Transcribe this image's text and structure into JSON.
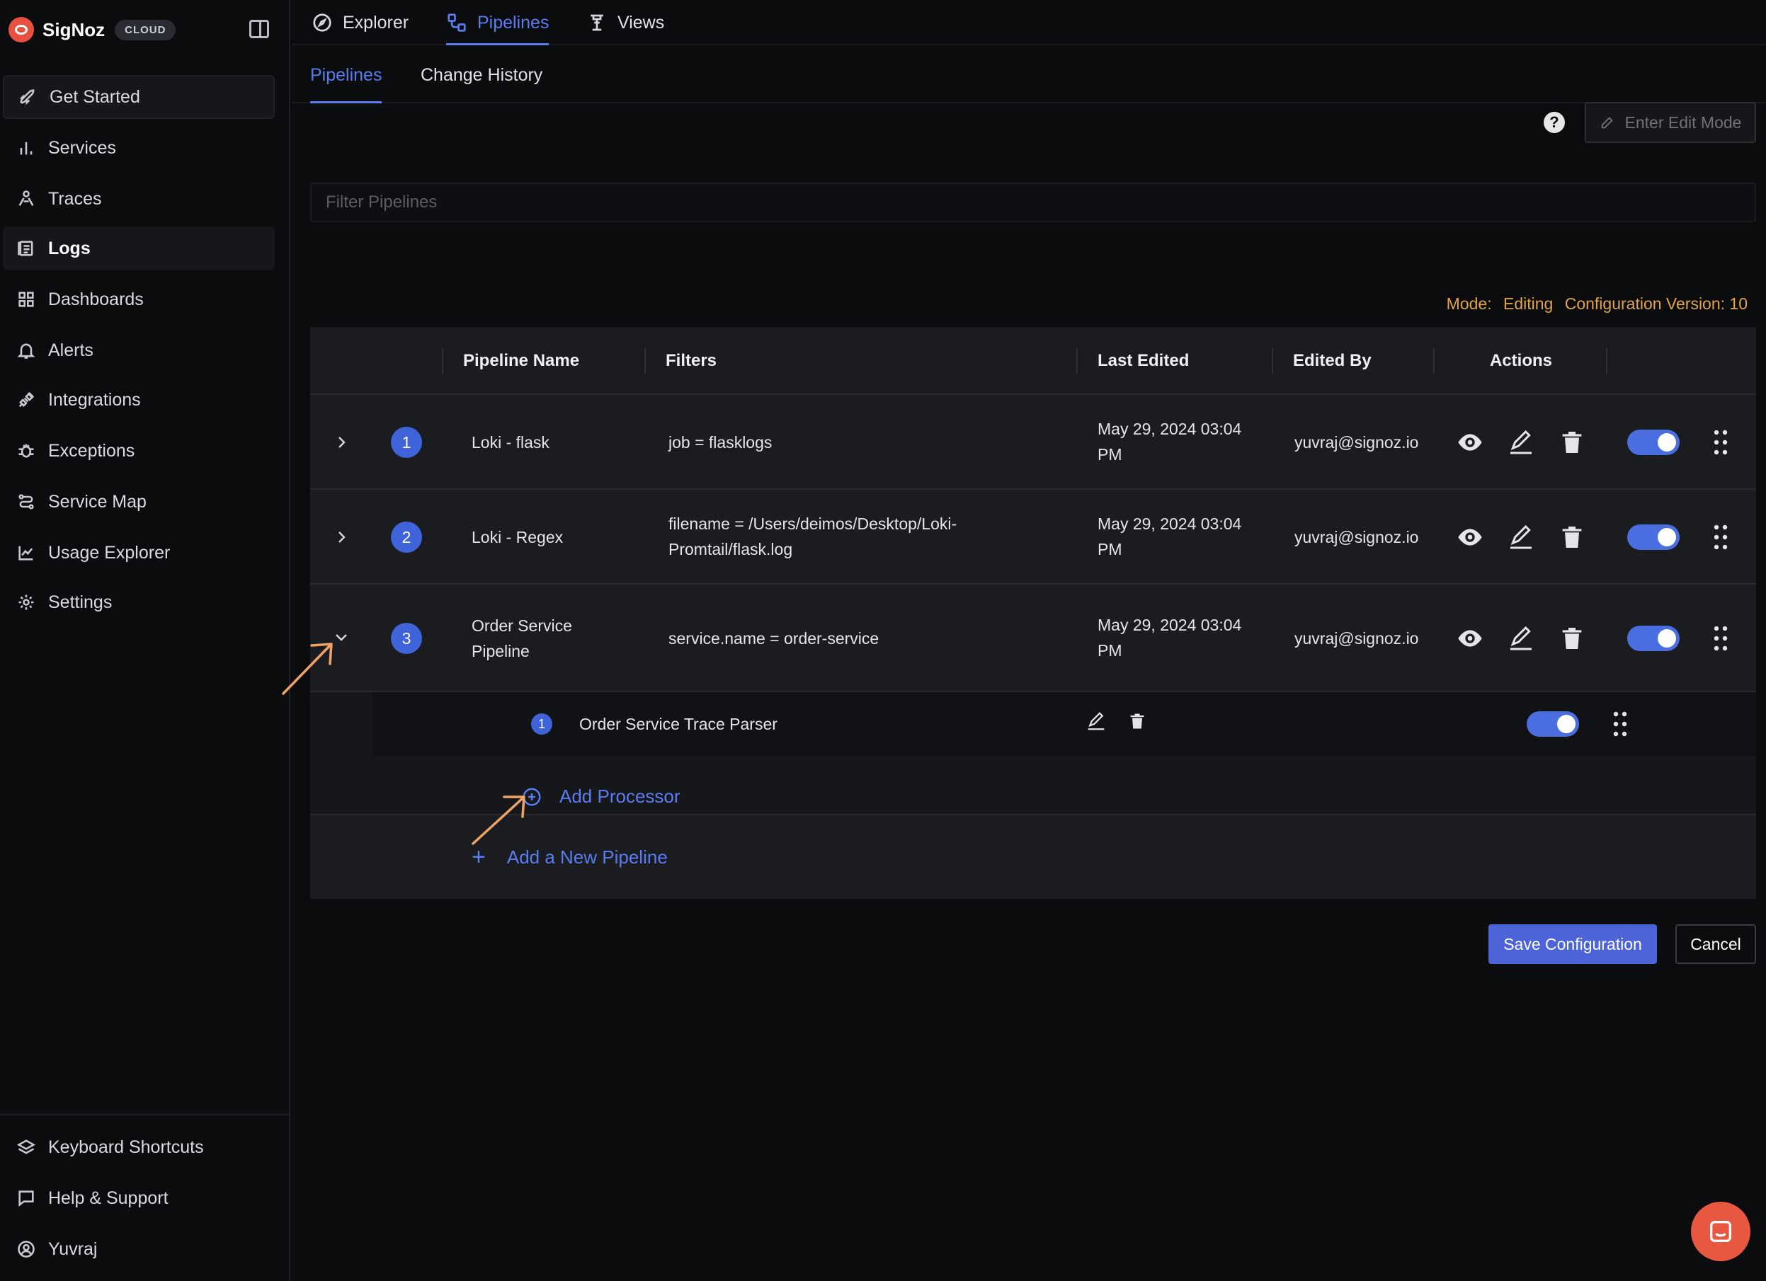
{
  "brand": {
    "name": "SigNoz",
    "badge": "CLOUD"
  },
  "sidebar": {
    "items": [
      {
        "label": "Get Started",
        "icon": "rocket-icon"
      },
      {
        "label": "Services",
        "icon": "bar-chart-icon"
      },
      {
        "label": "Traces",
        "icon": "route-icon"
      },
      {
        "label": "Logs",
        "icon": "logs-icon"
      },
      {
        "label": "Dashboards",
        "icon": "grid-icon"
      },
      {
        "label": "Alerts",
        "icon": "bell-icon"
      },
      {
        "label": "Integrations",
        "icon": "plug-icon"
      },
      {
        "label": "Exceptions",
        "icon": "bug-icon"
      },
      {
        "label": "Service Map",
        "icon": "route-map-icon"
      },
      {
        "label": "Usage Explorer",
        "icon": "line-chart-icon"
      },
      {
        "label": "Settings",
        "icon": "gear-icon"
      }
    ],
    "bottom": [
      {
        "label": "Keyboard Shortcuts",
        "icon": "layers-icon"
      },
      {
        "label": "Help & Support",
        "icon": "message-icon"
      },
      {
        "label": "Yuvraj",
        "icon": "user-circle-icon"
      }
    ]
  },
  "top_tabs": [
    "Explorer",
    "Pipelines",
    "Views"
  ],
  "sub_tabs": [
    "Pipelines",
    "Change History"
  ],
  "toolbar": {
    "help": "?",
    "edit_mode": "Enter Edit Mode"
  },
  "filter": {
    "placeholder": "Filter Pipelines",
    "value": ""
  },
  "mode": {
    "label": "Mode:",
    "value": "Editing",
    "version": "Configuration Version: 10"
  },
  "table": {
    "headers": [
      "Pipeline Name",
      "Filters",
      "Last Edited",
      "Edited By",
      "Actions"
    ],
    "rows": [
      {
        "index": "1",
        "name": "Loki - flask",
        "filter_1": "job = flasklogs",
        "filter_2": "",
        "edited_1": "May 29, 2024 03:04",
        "edited_2": "PM",
        "editor": "yuvraj@signoz.io",
        "enabled": true
      },
      {
        "index": "2",
        "name": "Loki - Regex",
        "filter_1": "filename = /Users/deimos/Desktop/Loki-",
        "filter_2": "Promtail/flask.log",
        "edited_1": "May 29, 2024 03:04",
        "edited_2": "PM",
        "editor": "yuvraj@signoz.io",
        "enabled": true
      },
      {
        "index": "3",
        "name_1": "Order Service",
        "name_2": "Pipeline",
        "filter_1": "service.name = order-service",
        "filter_2": "",
        "edited_1": "May 29, 2024 03:04",
        "edited_2": "PM",
        "editor": "yuvraj@signoz.io",
        "enabled": true
      }
    ],
    "processor": {
      "index": "1",
      "name": "Order Service Trace Parser",
      "enabled": true
    },
    "add_processor": "Add Processor",
    "add_pipeline": "Add a New Pipeline"
  },
  "footer": {
    "save": "Save Configuration",
    "cancel": "Cancel"
  },
  "colors": {
    "accent": "#5a7cf0",
    "mode_text": "#e1a34a",
    "save_button": "#4c64d8",
    "annotation_arrow": "#f0a366",
    "chat": "#e8573f"
  }
}
